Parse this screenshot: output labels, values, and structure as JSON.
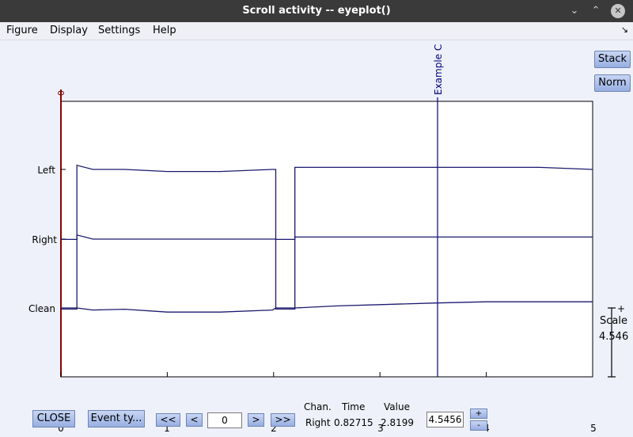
{
  "window": {
    "title": "Scroll activity -- eyeplot()"
  },
  "menu": {
    "items": [
      "Figure",
      "Display",
      "Settings",
      "Help"
    ]
  },
  "side_buttons": {
    "stack": "Stack",
    "norm": "Norm"
  },
  "plot": {
    "channels": [
      "Left",
      "Right",
      "Clean"
    ],
    "x_ticks": [
      "0",
      "1",
      "2",
      "3",
      "4",
      "5"
    ],
    "event_start_label": "0",
    "event_label": "Example C",
    "line_color": "#1a1a6e",
    "event_start_color": "#8b0000",
    "event_color": "#00007f"
  },
  "chart_data": {
    "type": "line",
    "x": [
      0,
      0.15,
      0.3,
      0.6,
      1.0,
      1.5,
      1.99,
      2.02,
      2.18,
      2.2,
      2.6,
      3.0,
      3.5,
      4.0,
      4.5,
      5.0
    ],
    "series": [
      {
        "name": "Left",
        "values": [
          -1.7,
          0.1,
          0.0,
          0.0,
          -0.05,
          -0.05,
          0.0,
          -1.7,
          -1.7,
          0.05,
          0.05,
          0.05,
          0.05,
          0.05,
          0.05,
          0.0
        ]
      },
      {
        "name": "Right",
        "values": [
          -1.7,
          0.1,
          0.0,
          0.0,
          0.0,
          0.0,
          0.0,
          -1.7,
          -1.7,
          0.05,
          0.05,
          0.05,
          0.05,
          0.05,
          0.05,
          0.05
        ]
      },
      {
        "name": "Clean",
        "values": [
          0.0,
          0.0,
          -0.05,
          -0.03,
          -0.1,
          -0.1,
          -0.05,
          0.0,
          0.0,
          0.0,
          0.05,
          0.08,
          0.12,
          0.15,
          0.15,
          0.15
        ]
      }
    ],
    "xlim": [
      0,
      5
    ],
    "event_x": [
      0,
      3.53
    ],
    "grid": false
  },
  "scale": {
    "label": "Scale",
    "value": "4.546",
    "plus": "+"
  },
  "bottom": {
    "close": "CLOSE",
    "event_type": "Event ty...",
    "nav_first": "<<",
    "nav_prev": "<",
    "position": "0",
    "nav_next": ">",
    "nav_last": ">>",
    "chan_header": "Chan.",
    "time_header": "Time",
    "value_header": "Value",
    "chan": "Right",
    "time": "0.82715",
    "value": "2.8199",
    "scale_field": "4.5456",
    "plus": "+",
    "minus": "-"
  }
}
